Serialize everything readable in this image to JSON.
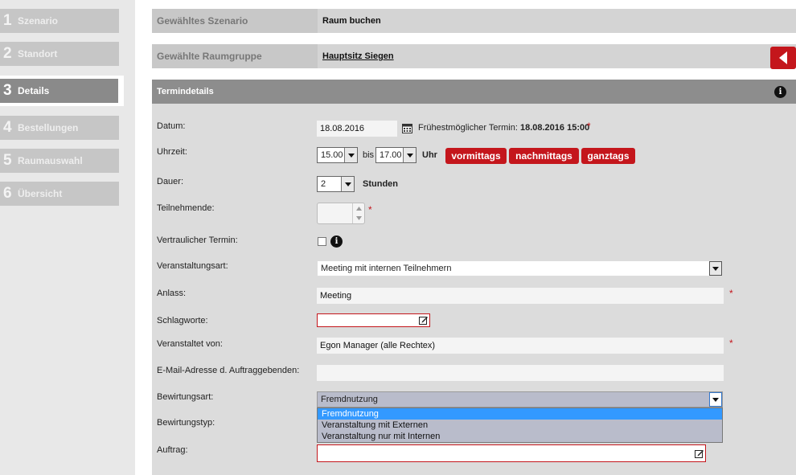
{
  "steps": [
    {
      "num": "1",
      "label": "Szenario"
    },
    {
      "num": "2",
      "label": "Standort"
    },
    {
      "num": "3",
      "label": "Details"
    },
    {
      "num": "4",
      "label": "Bestellungen"
    },
    {
      "num": "5",
      "label": "Raumauswahl"
    },
    {
      "num": "6",
      "label": "Übersicht"
    }
  ],
  "header": {
    "scenario_label": "Gewähltes Szenario",
    "scenario_value": "Raum buchen",
    "roomgroup_label": "Gewählte Raumgruppe",
    "roomgroup_value": "Hauptsitz Siegen"
  },
  "panel": {
    "title": "Termindetails",
    "info_glyph": "i"
  },
  "form": {
    "date_label": "Datum:",
    "date_value": "18.08.2016",
    "earliest_prefix": "Frühestmöglicher Termin:",
    "earliest_value": "18.08.2016 15:00",
    "required_mark": "*",
    "time_label": "Uhrzeit:",
    "time_from": "15.00",
    "time_between": "bis",
    "time_to": "17.00",
    "time_unit": "Uhr",
    "btn_morning": "vormittags",
    "btn_afternoon": "nachmittags",
    "btn_allday": "ganztags",
    "duration_label": "Dauer:",
    "duration_value": "2",
    "duration_unit": "Stunden",
    "participants_label": "Teilnehmende:",
    "confidential_label": "Vertraulicher Termin:",
    "eventtype_label": "Veranstaltungsart:",
    "eventtype_value": "Meeting mit internen Teilnehmern",
    "occasion_label": "Anlass:",
    "occasion_value": "Meeting",
    "keywords_label": "Schlagworte:",
    "organizer_label": "Veranstaltet von:",
    "organizer_value": "Egon Manager (alle Rechtex)",
    "email_label": "E-Mail-Adresse d. Auftraggebenden:",
    "catering_label": "Bewirtungsart:",
    "catering_value": "Fremdnutzung",
    "catering_options": [
      "Fremdnutzung",
      "Veranstaltung mit Externen",
      "Veranstaltung nur mit Internen"
    ],
    "cateringtype_label": "Bewirtungstyp:",
    "order_label": "Auftrag:"
  },
  "colors": {
    "accent": "#c4161c",
    "highlight": "#3399ff"
  }
}
